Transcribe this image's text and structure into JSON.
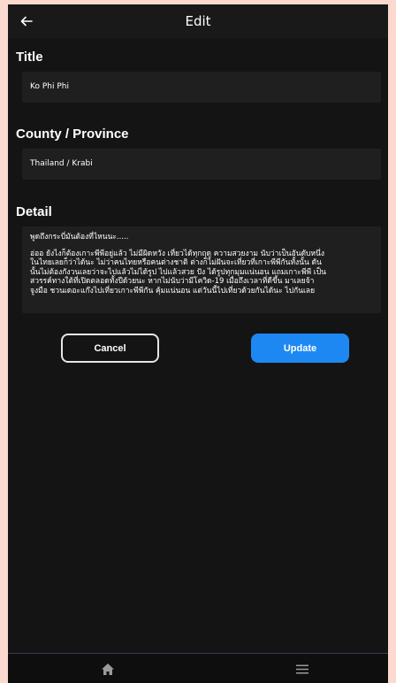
{
  "appbar": {
    "title": "Edit",
    "back_icon": "arrow-left-icon"
  },
  "form": {
    "title_label": "Title",
    "title_value": "Ko Phi Phi",
    "province_label": "County / Province",
    "province_value": "Thailand / Krabi",
    "detail_label": "Detail",
    "detail_lines": [
      "พูดถึงกระบี่มันต้องที่ไหนนะ.....",
      "",
      "อ่ออ ยังไงก็ต้องเกาะพีพีอยู่แล้ว ไม่มีผิดหวัง เที่ยวได้ทุกฤดู ความสวยงาม นับว่าเป็นอันดับหนึ่ง",
      "ในไทยเลยก็ว่าได้นะ ไม่ว่าคนไทยหรือคนต่างชาติ ต่างก็ไม่ฝันจะเที่ยวที่เกาะพีพีกันทั้งนั้น ดัน",
      "นั้นไม่ต้องกังวนเลยว่าจะไปแล้วไม่ได้รูป ไปแล้วสวย ปัง ได้รูปทุกมุมแน่นอน แถมเกาะพีพี เป็น",
      "สวรรค์ทางใต้ที่เปิดตลอดทั้งปีด้วยนะ หากไม่นับว่ามีโควิด-19 เมื่อถึงเวลาที่ดีขึ้น มาเลยจ้า",
      "จูงมือ ชวนเดอะแก๊งไปเที่ยวเกาะพีพีกัน คุ้มแน่นอน แต่วันนี้ไปเที่ยวด้วยกันได้นะ ไปกันเลย"
    ]
  },
  "buttons": {
    "cancel_label": "Cancel",
    "update_label": "Update"
  },
  "colors": {
    "accent": "#1e88f2",
    "background": "#141414",
    "field": "#1f1f1f",
    "outer": "#fbd9cf"
  },
  "bottom_nav": {
    "home_icon": "home-icon",
    "menu_icon": "menu-icon"
  }
}
